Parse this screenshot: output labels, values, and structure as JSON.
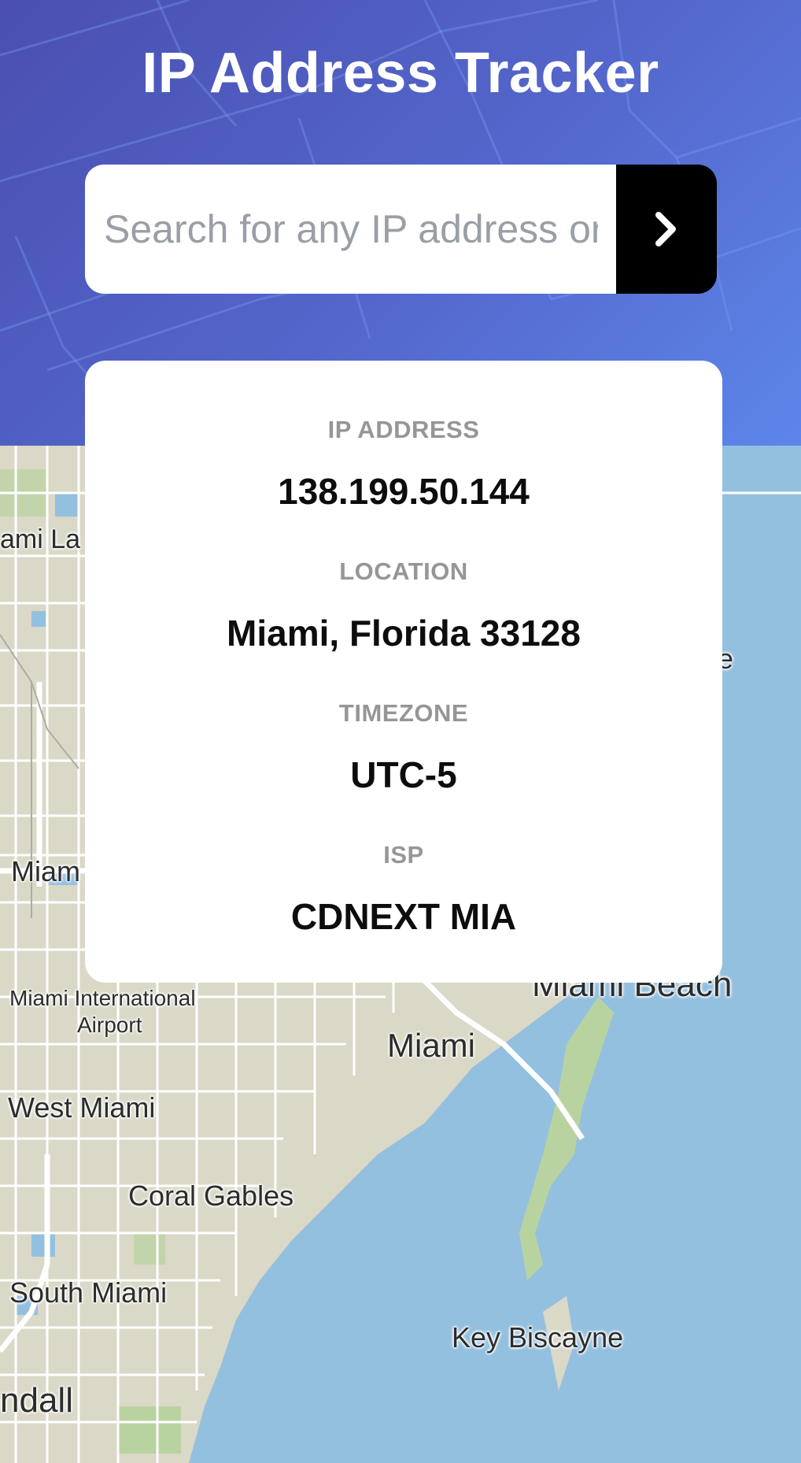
{
  "header": {
    "title": "IP Address Tracker"
  },
  "search": {
    "placeholder": "Search for any IP address or domain",
    "value": "",
    "button_icon": "chevron-right-icon"
  },
  "info": {
    "ip_label": "IP ADDRESS",
    "ip_value": "138.199.50.144",
    "location_label": "LOCATION",
    "location_value": "Miami, Florida 33128",
    "timezone_label": "TIMEZONE",
    "timezone_value": "UTC-5",
    "isp_label": "ISP",
    "isp_value": "CDNEXT MIA"
  },
  "map": {
    "labels": {
      "miami_lakes": "ami La",
      "miami_springs": "Miam",
      "miami_shores": "e",
      "airport": "Miami International",
      "airport_line2": "Airport",
      "miami_beach": "Miami Beach",
      "miami": "Miami",
      "west_miami": "West Miami",
      "coral_gables": "Coral Gables",
      "south_miami": "South Miami",
      "key_biscayne": "Key Biscayne",
      "kendall": "ndall"
    }
  },
  "colors": {
    "header_gradient_start": "#4a4fb0",
    "header_gradient_end": "#5d86ea",
    "button_bg": "#000000",
    "water": "#94c0e0",
    "land": "#dad8c7",
    "park": "#b9d3a0"
  }
}
